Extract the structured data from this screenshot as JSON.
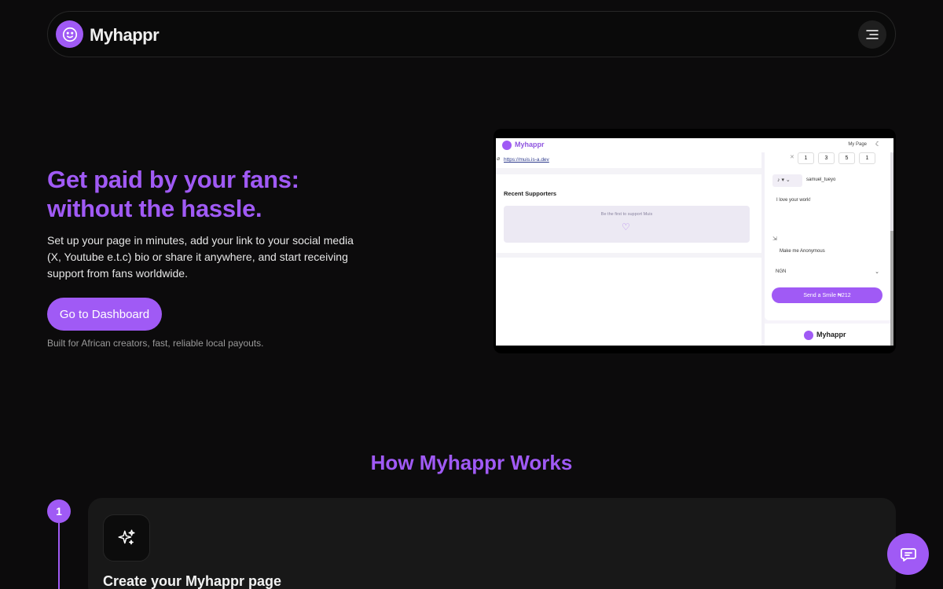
{
  "nav": {
    "brand": "Myhappr",
    "logo_icon": "smiley-icon",
    "menu_icon": "menu-icon"
  },
  "hero": {
    "title": "Get paid by your fans: without the hassle.",
    "description": "Set up your page in minutes, add your link to your social media (X, Youtube e.t.c) bio or share it anywhere, and start receiving support from fans worldwide.",
    "cta_label": "Go to Dashboard",
    "note": "Built for African creators, fast, reliable local payouts."
  },
  "preview": {
    "brand": "Myhappr",
    "my_page": "My Page",
    "link": "https://muis.is-a.dev",
    "recent_supporters": "Recent Supporters",
    "first_to_support": "Be the first to support Muis",
    "quantities": [
      "1",
      "3",
      "5",
      "1"
    ],
    "username": "samuel_tueyo",
    "message": "I love your work!",
    "anonymous_label": "Make me Anonymous",
    "currency": "NGN",
    "send_label": "Send a Smile ₦212",
    "footer_brand": "Myhappr"
  },
  "how": {
    "title": "How Myhappr Works",
    "steps": [
      {
        "number": "1",
        "title": "Create your Myhappr page",
        "icon": "sparkles-icon"
      }
    ]
  },
  "chat": {
    "icon": "chat-bubble-icon"
  },
  "colors": {
    "accent": "#a05af5",
    "background": "#0c0b0c"
  }
}
